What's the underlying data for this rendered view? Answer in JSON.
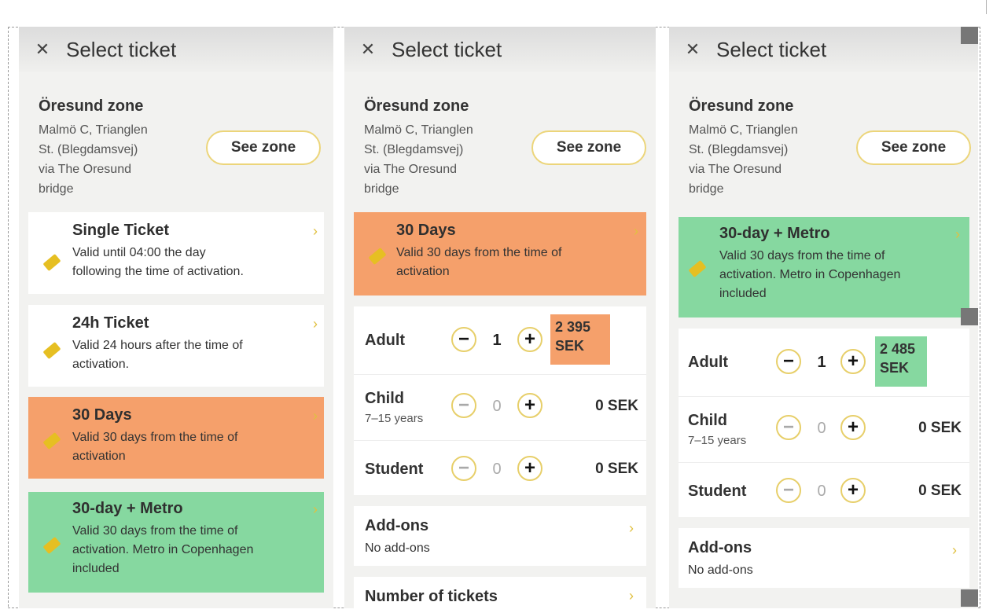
{
  "header": {
    "close_icon": "close-icon",
    "title": "Select ticket"
  },
  "zone": {
    "name": "Öresund zone",
    "desc_lines": [
      "Malmö C, Trianglen",
      "St. (Blegdamsvej)",
      "via The Oresund",
      "bridge"
    ],
    "see_zone_label": "See zone"
  },
  "tickets": [
    {
      "title": "Single Ticket",
      "desc": [
        "Valid until 04:00 the day",
        "following the time of activation."
      ]
    },
    {
      "title": "24h Ticket",
      "desc": [
        "Valid 24 hours after the time of",
        "activation."
      ]
    },
    {
      "title": "30 Days",
      "desc": [
        "Valid 30 days from the time of",
        "activation"
      ]
    },
    {
      "title": "30-day + Metro",
      "desc": [
        "Valid 30 days from the time of",
        "activation. Metro in Copenhagen",
        "included"
      ]
    }
  ],
  "quantities": {
    "adult_label": "Adult",
    "child_label": "Child",
    "child_sub": "7–15 years",
    "student_label": "Student",
    "minus": "−",
    "plus": "+",
    "adult_count": "1",
    "zero_count": "0",
    "zero_price": "0 SEK"
  },
  "panel2": {
    "adult_price_line1": "2 395",
    "adult_price_line2": "SEK"
  },
  "panel3": {
    "adult_price_line1": "2 485",
    "adult_price_line2": "SEK"
  },
  "addons": {
    "title": "Add-ons",
    "subtitle": "No add-ons"
  },
  "number_of_tickets": {
    "title": "Number of tickets"
  },
  "colors": {
    "orange": "#f5a06b",
    "green": "#86d8a0",
    "accent_yellow": "#e7cf6a"
  }
}
